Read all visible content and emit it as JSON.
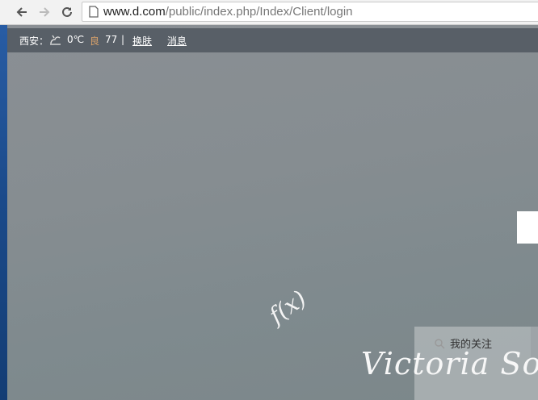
{
  "browser": {
    "url_host": "www.d.com",
    "url_path": "/public/index.php/Index/Client/login",
    "icons": [
      "back-icon",
      "forward-icon",
      "reload-icon",
      "page-icon"
    ]
  },
  "topbar": {
    "city": "西安：",
    "temperature": "0℃",
    "aq_level": "良",
    "aq_value": "77",
    "separator": "|",
    "skin_link": "换肤",
    "message_link": "消息"
  },
  "overlay": {
    "fx_text": "f(x)",
    "signature_text": "Victoria So",
    "panel_tab_label": "我的关注"
  },
  "colors": {
    "topbar_bg": "#585f67",
    "aq_level_color": "#d9a26a",
    "page_bg": "#868d91"
  }
}
